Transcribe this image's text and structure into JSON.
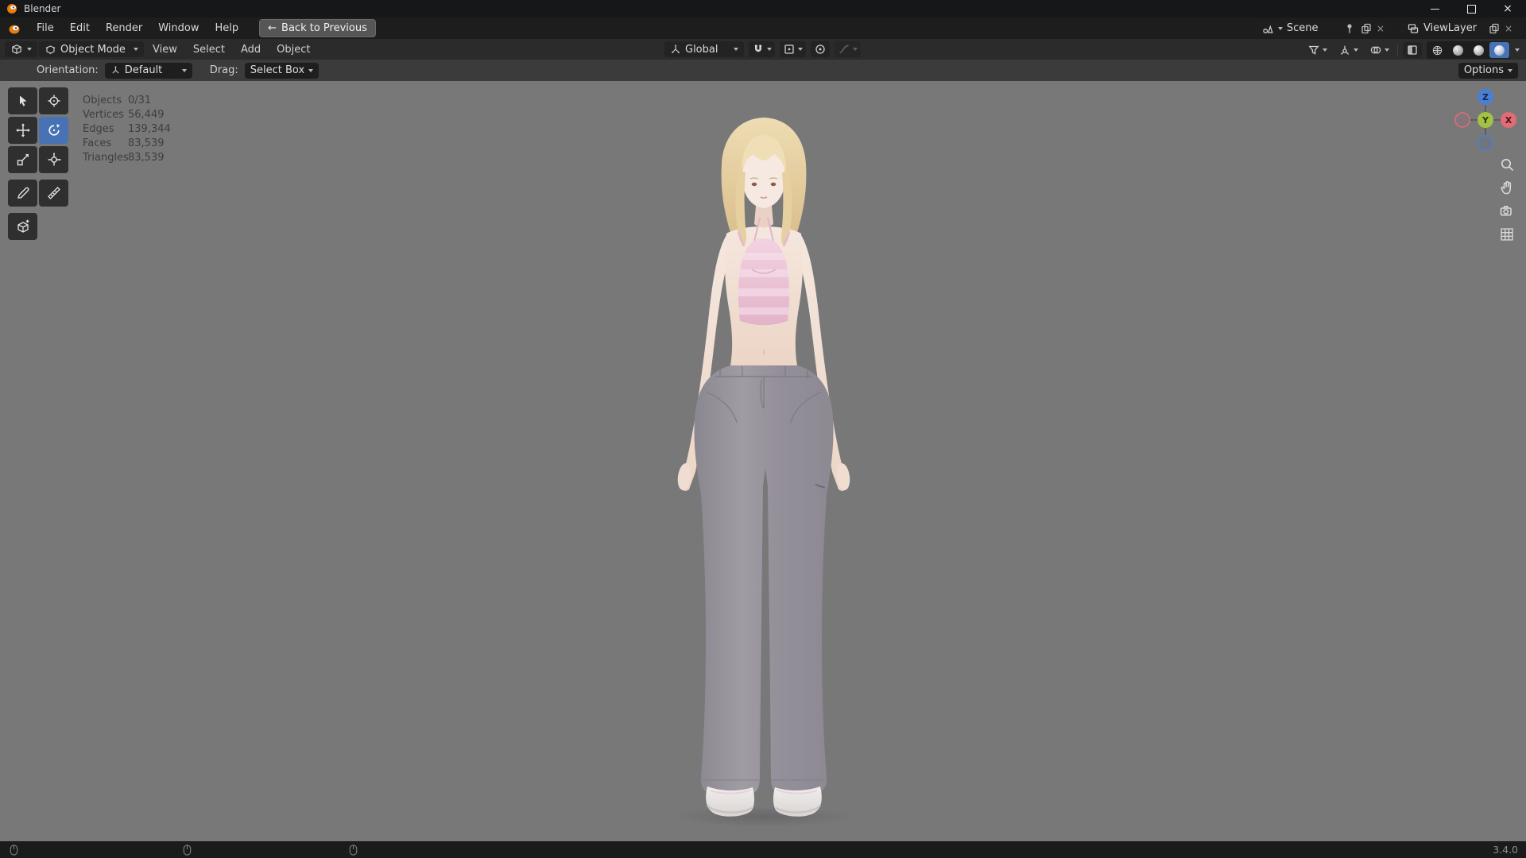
{
  "titlebar": {
    "title": "Blender"
  },
  "menubar": {
    "items": [
      "File",
      "Edit",
      "Render",
      "Window",
      "Help"
    ],
    "back_to_previous": "Back to Previous"
  },
  "scene_selector": {
    "scene": "Scene",
    "view_layer": "ViewLayer"
  },
  "viewport_header": {
    "mode": "Object Mode",
    "menus": [
      "View",
      "Select",
      "Add",
      "Object"
    ],
    "transform_orientation": "Global"
  },
  "tool_settings": {
    "orientation_label": "Orientation:",
    "orientation_value": "Default",
    "drag_label": "Drag:",
    "drag_value": "Select Box",
    "options_label": "Options"
  },
  "stats": {
    "rows": [
      {
        "label": "Objects",
        "value": "0/31"
      },
      {
        "label": "Vertices",
        "value": "56,449"
      },
      {
        "label": "Edges",
        "value": "139,344"
      },
      {
        "label": "Faces",
        "value": "83,539"
      },
      {
        "label": "Triangles",
        "value": "83,539"
      }
    ]
  },
  "axis_gizmo": {
    "x": "X",
    "y": "Y",
    "z": "Z"
  },
  "statusbar": {
    "version": "3.4.0"
  },
  "glyphs": {
    "back_arrow": "←",
    "close": "×"
  },
  "colors": {
    "accent_blue": "#4772b3",
    "viewport_gray": "#787879",
    "axis_x_red": "#e06c75",
    "axis_y_green": "#a3c244",
    "axis_z_blue": "#4a7fd6"
  }
}
